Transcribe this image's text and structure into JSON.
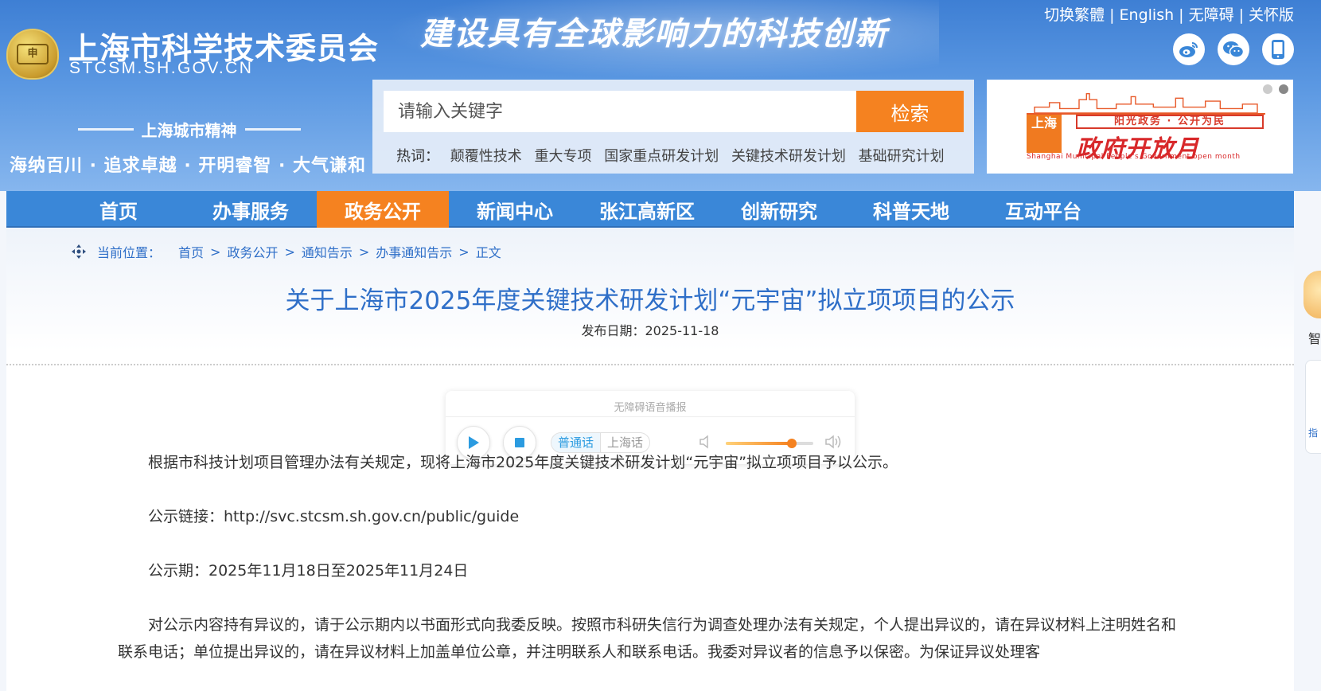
{
  "header": {
    "site_name": "上海市科学技术委员会",
    "site_domain": "STCSM.SH.GOV.CN",
    "logo_text": "申",
    "slogan": "建设具有全球影响力的科技创新",
    "spirit_title": "上海城市精神",
    "spirit_text": "海纳百川 · 追求卓越 · 开明睿智 · 大气谦和",
    "top_links": [
      "切换繁體",
      "English",
      "无障碍",
      "关怀版"
    ],
    "social_icons": [
      "weibo-icon",
      "wechat-icon",
      "mobile-icon"
    ]
  },
  "search": {
    "placeholder": "请输入关键字",
    "button_label": "检索",
    "hot_label": "热词：",
    "hot_words": [
      "颠覆性技术",
      "重大专项",
      "国家重点研发计划",
      "关键技术研发计划",
      "基础研究计划"
    ]
  },
  "banner": {
    "sh_text": "上海",
    "sub_title": "阳光政务 · 公开为民",
    "main_title": "政府开放月",
    "en_title": "Shanghai Municipal People's Government open month",
    "slide_count": 2,
    "active_slide": 2
  },
  "nav": {
    "items": [
      "首页",
      "办事服务",
      "政务公开",
      "新闻中心",
      "张江高新区",
      "创新研究",
      "科普天地",
      "互动平台"
    ],
    "active_index": 2
  },
  "breadcrumb": {
    "label": "当前位置：",
    "items": [
      "首页",
      "政务公开",
      "通知告示",
      "办事通知告示",
      "正文"
    ]
  },
  "article": {
    "title": "关于上海市2025年度关键技术研发计划“元宇宙”拟立项项目的公示",
    "publish_date": "发布日期：2025-11-18",
    "paragraphs": [
      "根据市科技计划项目管理办法有关规定，现将上海市2025年度关键技术研发计划“元宇宙”拟立项项目予以公示。",
      "公示链接：http://svc.stcsm.sh.gov.cn/public/guide",
      "公示期：2025年11月18日至2025年11月24日",
      "对公示内容持有异议的，请于公示期内以书面形式向我委反映。按照市科研失信行为调查处理办法有关规定，个人提出异议的，请在异议材料上注明姓名和联系电话；单位提出异议的，请在异议材料上加盖单位公章，并注明联系人和联系电话。我委对异议者的信息予以保密。为保证异议处理客"
    ]
  },
  "player": {
    "title": "无障碍语音播报",
    "lang_options": [
      "普通话",
      "上海话"
    ],
    "active_lang": "普通话",
    "volume": 0.75
  },
  "side": {
    "widget1_text": "智",
    "widget2_text": "指"
  },
  "colors": {
    "brand_blue": "#3a87d8",
    "accent_orange": "#f58220",
    "link_blue": "#2f6fc8"
  }
}
